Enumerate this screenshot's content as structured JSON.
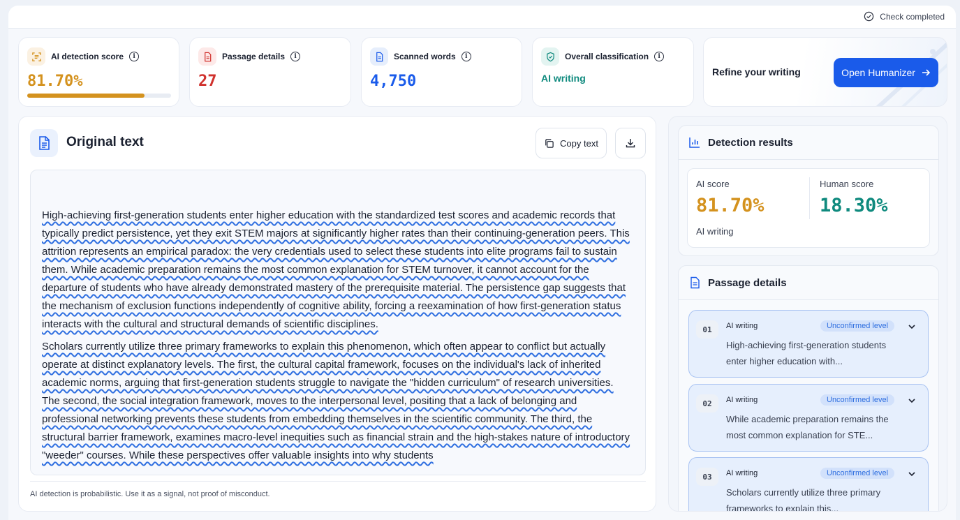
{
  "status": {
    "text": "Check completed"
  },
  "cards": {
    "ai_score": {
      "label": "AI detection score",
      "value": "81.70%",
      "progress": 0.817
    },
    "passage": {
      "label": "Passage details",
      "value": "27"
    },
    "words": {
      "label": "Scanned words",
      "value": "4,750"
    },
    "classification": {
      "label": "Overall classification",
      "value": "AI writing"
    }
  },
  "refine": {
    "title": "Refine your writing",
    "button": "Open Humanizer"
  },
  "original": {
    "title": "Original text",
    "copy_label": "Copy text",
    "paragraphs": [
      "High-achieving first-generation students enter higher education with the standardized test scores and academic records that typically predict persistence, yet they exit STEM majors at significantly higher rates than their continuing-generation peers. This attrition represents an empirical paradox: the very credentials used to select these students into elite programs fail to sustain them. While academic preparation remains the most common explanation for STEM turnover, it cannot account for the departure of students who have already demonstrated mastery of the prerequisite material. The persistence gap suggests that the mechanism of exclusion functions independently of cognitive ability, forcing a reexamination of how first-generation status interacts with the cultural and structural demands of scientific disciplines.",
      "Scholars currently utilize three primary frameworks to explain this phenomenon, which often appear to conflict but actually operate at distinct explanatory levels. The first, the cultural capital framework, focuses on the individual's lack of inherited academic norms, arguing that first-generation students struggle to navigate the \"hidden curriculum\" of research universities. The second, the social integration framework, moves to the interpersonal level, positing that a lack of belonging and professional networking prevents these students from embedding themselves in the scientific community. The third, the structural barrier framework, examines macro-level inequities such as financial strain and the high-stakes nature of introductory \"weeder\" courses. While these perspectives offer valuable insights into why students"
    ],
    "footnote": "AI detection is probabilistic. Use it as a signal, not proof of misconduct."
  },
  "detection": {
    "title": "Detection results",
    "ai_label": "AI score",
    "ai_value": "81.70%",
    "ai_sub": "AI writing",
    "human_label": "Human score",
    "human_value": "18.30%"
  },
  "passages": {
    "title": "Passage details",
    "items": [
      {
        "num": "01",
        "kind": "AI writing",
        "badge": "Unconfirmed level",
        "snippet": "High-achieving first-generation students enter higher education with..."
      },
      {
        "num": "02",
        "kind": "AI writing",
        "badge": "Unconfirmed level",
        "snippet": "While academic preparation remains the most common explanation for STE..."
      },
      {
        "num": "03",
        "kind": "AI writing",
        "badge": "Unconfirmed level",
        "snippet": "Scholars currently utilize three primary frameworks to explain this..."
      }
    ]
  },
  "colors": {
    "accent": "#1a5bea",
    "ai": "#d4921e",
    "human": "#0f8a7e",
    "passage_red": "#d0312d",
    "words_blue": "#1a5bea"
  }
}
